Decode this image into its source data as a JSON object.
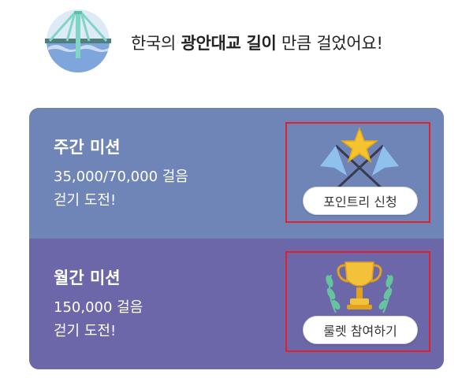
{
  "header": {
    "prefix": "한국의 ",
    "highlight": "광안대교 길이",
    "suffix": " 만큼 걸었어요!"
  },
  "missions": [
    {
      "title": "주간 미션",
      "progress": "35,000/70,000 걸음",
      "subtitle": "걷기 도전!",
      "button": "포인트리 신청",
      "reward_icon": "flags-star-icon"
    },
    {
      "title": "월간 미션",
      "progress": "150,000 걸음",
      "subtitle": "걷기 도전!",
      "button": "룰렛 참여하기",
      "reward_icon": "trophy-icon"
    }
  ],
  "colors": {
    "weekly_bg": "#6f85b8",
    "monthly_bg": "#6b67a8",
    "highlight_border": "#e0202a"
  }
}
